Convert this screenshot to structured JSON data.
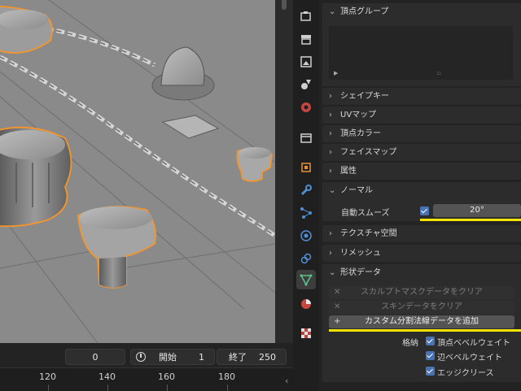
{
  "timeline": {
    "current_frame": "0",
    "start_label": "開始",
    "start_value": "1",
    "end_label": "終了",
    "end_value": "250",
    "ruler_ticks": [
      "120",
      "140",
      "160",
      "180"
    ]
  },
  "tabs": [
    "tool-icon",
    "render-icon",
    "output-icon",
    "view-layer-icon",
    "scene-icon",
    "world-icon",
    "collection-icon",
    "object-icon",
    "modifier-icon",
    "particles-icon",
    "physics-icon",
    "constraints-icon",
    "data-icon",
    "material-icon",
    "texture-icon"
  ],
  "properties": {
    "vertex_groups": {
      "title": "頂点グループ"
    },
    "shape_keys": {
      "title": "シェイプキー"
    },
    "uv_maps": {
      "title": "UVマップ"
    },
    "vertex_colors": {
      "title": "頂点カラー"
    },
    "face_maps": {
      "title": "フェイスマップ"
    },
    "attributes": {
      "title": "属性"
    },
    "normals": {
      "title": "ノーマル",
      "auto_smooth_label": "自動スムーズ",
      "auto_smooth_checked": true,
      "angle": "20°"
    },
    "texture_space": {
      "title": "テクスチャ空間"
    },
    "remesh": {
      "title": "リメッシュ"
    },
    "geometry_data": {
      "title": "形状データ",
      "clear_sculpt_mask": "スカルプトマスクデータをクリア",
      "clear_skin": "スキンデータをクリア",
      "add_custom_normals": "カスタム分割法線データを追加",
      "store_label": "格納",
      "vertex_bevel_weight": "頂点ベベルウェイト",
      "edge_bevel_weight": "辺ベベルウェイト",
      "edge_crease": "エッジクリース"
    }
  },
  "colors": {
    "highlight": "#f2e400",
    "selection_outline": "#f5952a",
    "checkbox": "#4772b3",
    "active_tab_data": "#5bc48a"
  }
}
